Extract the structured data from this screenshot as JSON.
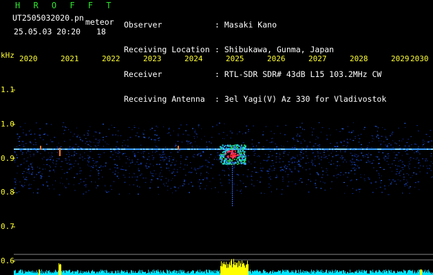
{
  "station": "H R O F F T",
  "filename": "UT2505032020.pn",
  "class_label": "meteor",
  "datetime": "25.05.03 20:20",
  "count": "18",
  "info_labels": {
    "observer": "Observer",
    "location": "Receiving Location",
    "receiver": "Receiver",
    "antenna": "Receiving Antenna"
  },
  "info_values": {
    "observer": ": Masaki Kano",
    "location": ": Shibukawa, Gunma, Japan",
    "receiver": ": RTL-SDR SDR# 43dB L15 103.2MHz CW",
    "antenna": ": 3el Yagi(V) Az 330 for Vladivostok"
  },
  "y_unit": "kHz",
  "time_ticks": [
    "2020",
    "2021",
    "2022",
    "2023",
    "2024",
    "2025",
    "2026",
    "2027",
    "2028",
    "2029",
    "2030"
  ],
  "freq_ticks": [
    "1.1",
    "1.0",
    "0.9",
    "0.8",
    "0.7",
    "0.6"
  ],
  "colors": {
    "label": "#ffff33",
    "title": "#2ee62e",
    "text": "#ffffff",
    "signal_bar": "#ffff00",
    "noise_bar": "#00e5ff"
  }
}
